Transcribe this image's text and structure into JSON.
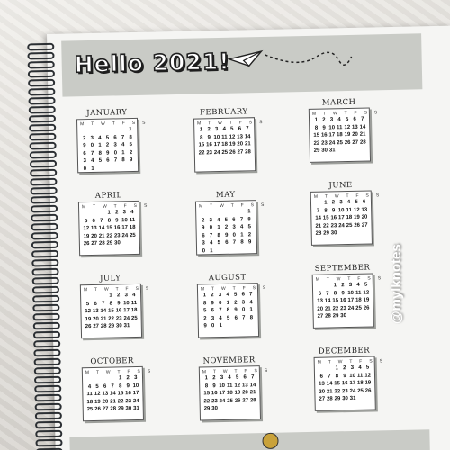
{
  "header": {
    "title": "Hello 2021!"
  },
  "calendar": {
    "weekday_header": "M T W T F S S",
    "months": [
      {
        "name": "JANUARY",
        "days": "                  1  2  3  4  5  6  7  8  9 10 11 12 13 14 15 16 17 18 19 20 21 22 23 24 25 26 27 28 29 30 31"
      },
      {
        "name": "FEBRUARY",
        "days": " 1  2  3  4  5  6  7  8  9 10 11 12 13 14 15 16 17 18 19 20 21 22 23 24 25 26 27 28"
      },
      {
        "name": "MARCH",
        "days": " 1  2  3  4  5  6  7  8  9 10 11 12 13 14 15 16 17 18 19 20 21 22 23 24 25 26 27 28 29 30 31"
      },
      {
        "name": "APRIL",
        "days": "          1  2  3  4  5  6  7  8  9 10 11 12 13 14 15 16 17 18 19 20 21 22 23 24 25 26 27 28 29 30"
      },
      {
        "name": "MAY",
        "days": "                  1  2  3  4  5  6  7  8  9 10 11 12 13 14 15 16 17 18 19 20 21 22 23 24 25 26 27 28 29 30 31"
      },
      {
        "name": "JUNE",
        "days": "    1  2  3  4  5  6  7  8  9 10 11 12 13 14 15 16 17 18 19 20 21 22 23 24 25 26 27 28 29 30"
      },
      {
        "name": "JULY",
        "days": "          1  2  3  4  5  6  7  8  9 10 11 12 13 14 15 16 17 18 19 20 21 22 23 24 25 26 27 28 29 30 31"
      },
      {
        "name": "AUGUST",
        "days": "                     1  2  3  4  5  6  7  8  9 10 11 12 13 14 15 16 17 18 19 20 21 22 23 24 25 26 27 28 29 30 31"
      },
      {
        "name": "SEPTEMBER",
        "days": "       1  2  3  4  5  6  7  8  9 10 11 12 13 14 15 16 17 18 19 20 21 22 23 24 25 26 27 28 29 30"
      },
      {
        "name": "OCTOBER",
        "days": "             1  2  3  4  5  6  7  8  9 10 11 12 13 14 15 16 17 18 19 20 21 22 23 24 25 26 27 28 29 30 31"
      },
      {
        "name": "NOVEMBER",
        "days": " 1  2  3  4  5  6  7  8  9 10 11 12 13 14 15 16 17 18 19 20 21 22 23 24 25 26 27 28 29 30"
      },
      {
        "name": "DECEMBER",
        "days": "       1  2  3  4  5  6  7  8  9 10 11 12 13 14 15 16 17 18 19 20 21 22 23 24 25 26 27 28 29 30 31"
      }
    ]
  },
  "watermark": {
    "text": "@mylknotes"
  },
  "colors": {
    "band": "#c9cbc6",
    "paper": "#f5f5f3",
    "cardboard": "#b8946f",
    "ink": "#1e1e1e"
  }
}
